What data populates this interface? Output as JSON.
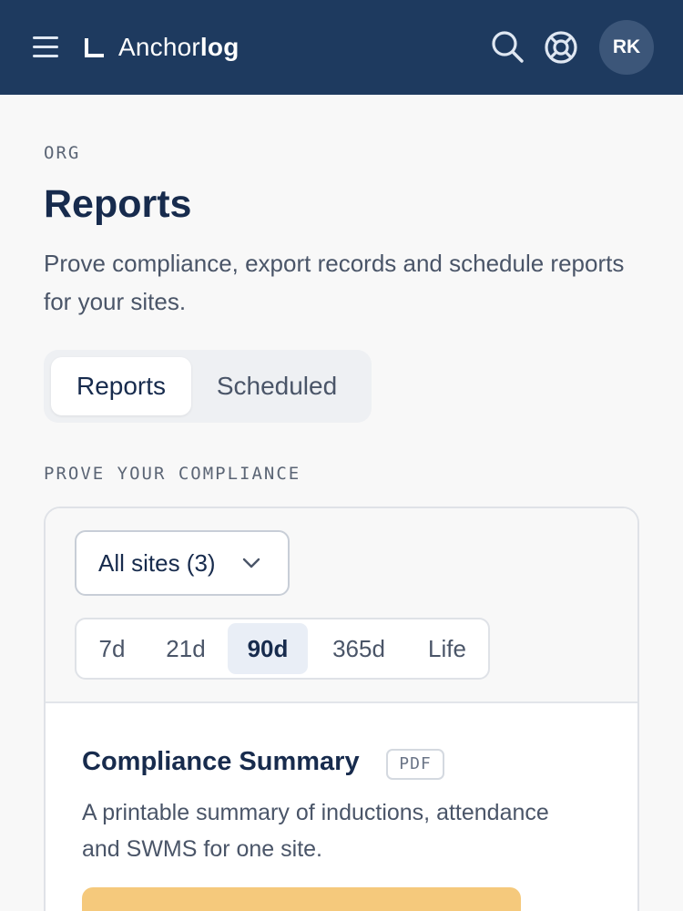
{
  "header": {
    "brand_light": "Anchor",
    "brand_bold": "log",
    "avatar_initials": "RK",
    "icons": [
      "menu-icon",
      "logo-mark-icon",
      "search-icon",
      "help-lifebuoy-icon"
    ]
  },
  "page": {
    "eyebrow": "ORG",
    "title": "Reports",
    "description": "Prove compliance, export records and schedule reports for your sites."
  },
  "tabs": [
    {
      "label": "Reports",
      "active": true
    },
    {
      "label": "Scheduled",
      "active": false
    }
  ],
  "section": {
    "label": "PROVE YOUR COMPLIANCE"
  },
  "filters": {
    "site_select": "All sites (3)",
    "ranges": [
      {
        "label": "7d",
        "active": false
      },
      {
        "label": "21d",
        "active": false
      },
      {
        "label": "90d",
        "active": true
      },
      {
        "label": "365d",
        "active": false
      },
      {
        "label": "Life",
        "active": false
      }
    ]
  },
  "report": {
    "title": "Compliance Summary",
    "format": "PDF",
    "description": "A printable summary of inductions, attendance and SWMS for one site."
  },
  "colors": {
    "header_bg": "#1e3a5f",
    "accent_button": "#f5c97c",
    "active_range_bg": "#e9eef6",
    "text_primary": "#172b4d"
  }
}
